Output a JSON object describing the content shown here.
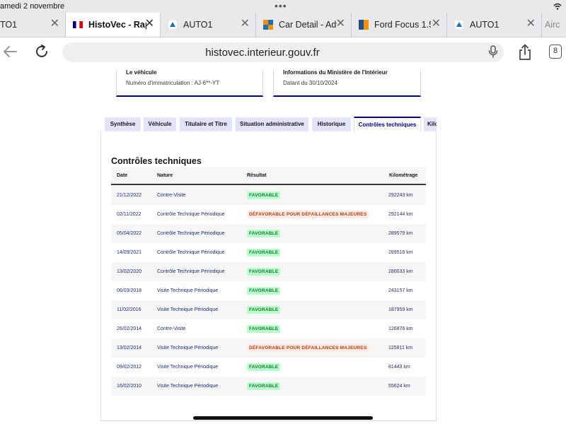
{
  "status_bar": {
    "date": "amedi 2 novembre",
    "dots": "•••"
  },
  "browser_tabs": [
    {
      "title": "TO1",
      "favicon": "auto1-icon",
      "active": false
    },
    {
      "title": "HistoVec - Rapp",
      "favicon": "french-flag-icon",
      "active": true
    },
    {
      "title": "AUTO1",
      "favicon": "auto1-icon",
      "active": false
    },
    {
      "title": "Car Detail - Adv",
      "favicon": "car-detail-icon",
      "active": false
    },
    {
      "title": "Ford Focus 1.5",
      "favicon": "ford-focus-icon",
      "active": false
    },
    {
      "title": "AUTO1",
      "favicon": "auto1-icon",
      "active": false
    },
    {
      "title": "Airc",
      "favicon": "",
      "active": false
    }
  ],
  "toolbar": {
    "url": "histovec.interieur.gouv.fr",
    "tab_count": "8"
  },
  "info_boxes": {
    "vehicle": {
      "title": "Le véhicule",
      "value": "Numéro d'immatriculation : AJ-6**-YT"
    },
    "ministry": {
      "title": "Informations du Ministère de l'Intérieur",
      "value": "Datant du 30/10/2024"
    }
  },
  "nav_tabs": [
    {
      "label": "Synthèse",
      "selected": false
    },
    {
      "label": "Véhicule",
      "selected": false
    },
    {
      "label": "Titulaire et Titre",
      "selected": false
    },
    {
      "label": "Situation administrative",
      "selected": false
    },
    {
      "label": "Historique",
      "selected": false
    },
    {
      "label": "Contrôles techniques",
      "selected": true
    },
    {
      "label": "Kilo",
      "selected": false
    }
  ],
  "section_title": "Contrôles techniques",
  "table": {
    "headers": {
      "date": "Date",
      "nature": "Nature",
      "result": "Résultat",
      "km": "Kilométrage"
    },
    "rows": [
      {
        "date": "21/12/2022",
        "nature": "Contre-Visite",
        "result": "FAVORABLE",
        "status": "fav",
        "km": "292243 km"
      },
      {
        "date": "02/11/2022",
        "nature": "Contrôle Technique Périodique",
        "result": "DÉFAVORABLE POUR DÉFAILLANCES MAJEURES",
        "status": "def",
        "km": "292144 km"
      },
      {
        "date": "05/04/2022",
        "nature": "Contrôle Technique Périodique",
        "result": "FAVORABLE",
        "status": "fav",
        "km": "289579 km"
      },
      {
        "date": "14/09/2021",
        "nature": "Contrôle Technique Périodique",
        "result": "FAVORABLE",
        "status": "fav",
        "km": "289516 km"
      },
      {
        "date": "13/02/2020",
        "nature": "Contrôle Technique Périodique",
        "result": "FAVORABLE",
        "status": "fav",
        "km": "280033 km"
      },
      {
        "date": "06/03/2018",
        "nature": "Visite Technique Périodique",
        "result": "FAVORABLE",
        "status": "fav",
        "km": "243157 km"
      },
      {
        "date": "11/02/2016",
        "nature": "Visite Technique Périodique",
        "result": "FAVORABLE",
        "status": "fav",
        "km": "187959 km"
      },
      {
        "date": "26/02/2014",
        "nature": "Contre-Visite",
        "result": "FAVORABLE",
        "status": "fav",
        "km": "126876 km"
      },
      {
        "date": "13/02/2014",
        "nature": "Visite Technique Périodique",
        "result": "DÉFAVORABLE POUR DÉFAILLANCES MAJEURES",
        "status": "def",
        "km": "125811 km"
      },
      {
        "date": "09/02/2012",
        "nature": "Visite Technique Périodique",
        "result": "FAVORABLE",
        "status": "fav",
        "km": "81443 km"
      },
      {
        "date": "16/02/2010",
        "nature": "Visite Technique Périodique",
        "result": "FAVORABLE",
        "status": "fav",
        "km": "55624 km"
      }
    ]
  },
  "colors": {
    "accent": "#000091",
    "favorable_bg": "#b8fec9",
    "favorable_text": "#18753c",
    "defavorable_bg": "#ffe9e6",
    "defavorable_text": "#b34000",
    "tab_bg": "#e3e3fd"
  }
}
